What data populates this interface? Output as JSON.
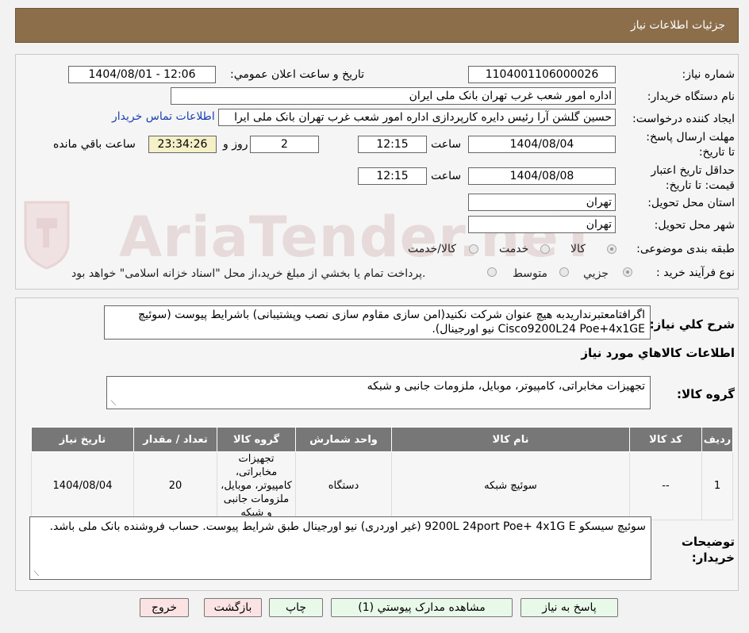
{
  "header": {
    "title": "جزئیات اطلاعات نیاز"
  },
  "watermark": "AriaTender.neT",
  "form": {
    "need_number_label": "شماره نیاز:",
    "need_number": "1104001106000026",
    "announce_label": "تاریخ و ساعت اعلان عمومي:",
    "announce_value": "1404/08/01 - 12:06",
    "buyer_org_label": "نام دستگاه خريدار:",
    "buyer_org": "اداره امور شعب غرب تهران بانک ملی ایران",
    "creator_label": "ايجاد کننده درخواست:",
    "creator": "حسین گلشن آرا رئیس دایره کارپردازی اداره امور شعب غرب تهران بانک ملی ایرا",
    "contact_link": "اطلاعات تماس خريدار",
    "deadline_label": "مهلت ارسال پاسخ: تا تاریخ:",
    "deadline_date": "1404/08/04",
    "time_label": "ساعت",
    "deadline_time": "12:15",
    "days_value": "2",
    "days_label": "روز و",
    "remaining_time": "23:34:26",
    "remaining_label": "ساعت باقي مانده",
    "validity_label": "حداقل تاريخ اعتبار قيمت: تا تاریخ:",
    "validity_date": "1404/08/08",
    "validity_time": "12:15",
    "province_label": "استان محل تحويل:",
    "province": "تهران",
    "city_label": "شهر محل تحويل:",
    "city": "تهران",
    "category_label": "طبقه بندی موضوعی:",
    "category_options": [
      "کالا",
      "خدمت",
      "کالا/خدمت"
    ],
    "category_selected": "کالا",
    "process_label": "نوع فرآيند خريد :",
    "process_options": [
      "جزيي",
      "متوسط"
    ],
    "process_note": "پرداخت تمام يا بخشي از مبلغ خريد،از محل \"اسناد خزانه اسلامی\" خواهد بود."
  },
  "description": {
    "label": "شرح کلي نياز:",
    "text": "اگرافتامعتبرنداریدبه هیچ عنوان شرکت نکنید(امن سازی مقاوم سازی نصب وپشتیبانی) باشرایط پیوست (سوئیچ Cisco9200L24 Poe+4x1GE نیو اورجینال)."
  },
  "goods": {
    "section_title": "اطلاعات کالاهاي مورد نياز",
    "group_label": "گروه کالا:",
    "group_value": "تجهیزات مخابراتی، کامپیوتر، موبایل، ملزومات جانبی و شبکه",
    "table": {
      "headers": [
        "رديف",
        "کد کالا",
        "نام کالا",
        "واحد شمارش",
        "گروه کالا",
        "تعداد / مقدار",
        "تاريخ نياز"
      ],
      "rows": [
        [
          "1",
          "--",
          "سوئیچ شبکه",
          "دستگاه",
          "تجهیزات مخابراتی، کامپیوتر، موبایل، ملزومات جانبی و شبکه",
          "20",
          "1404/08/04"
        ]
      ]
    }
  },
  "buyer_notes": {
    "label": "توضيحات خريدار:",
    "text": "سوئیچ سیسکو 9200L 24port Poe+ 4x1G E (غیر اوردری) نیو اورجینال طبق شرایط پیوست. حساب فروشنده بانک ملی باشد."
  },
  "buttons": {
    "reply": "پاسخ به نياز",
    "attachments": "مشاهده مدارک پيوستي (1)",
    "print": "چاپ",
    "back": "بازگشت",
    "exit": "خروج"
  }
}
